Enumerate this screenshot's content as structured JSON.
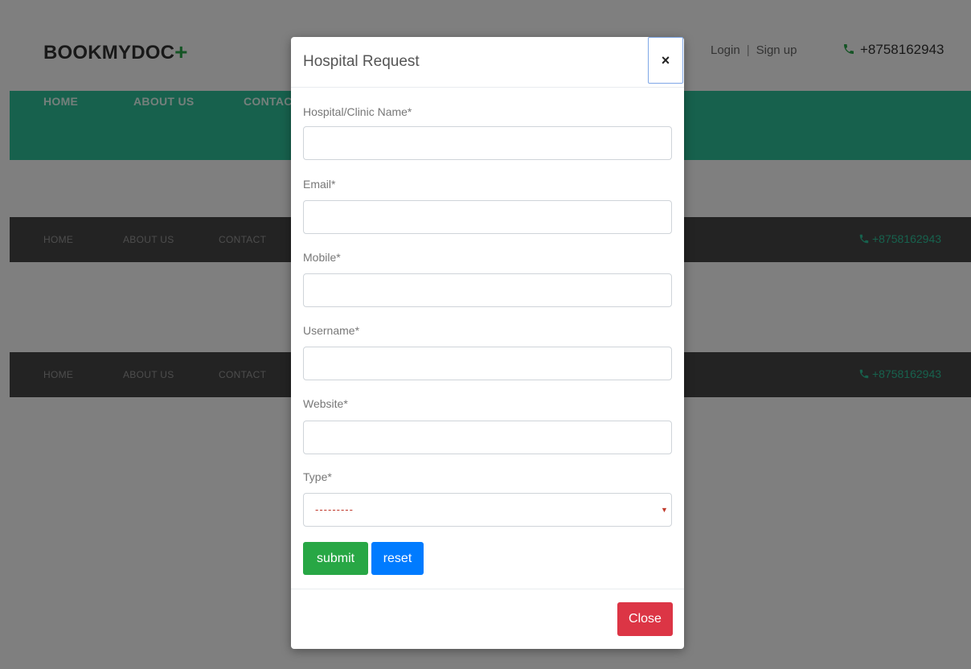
{
  "header": {
    "brand_text": "BOOKMYDOC",
    "brand_plus": "+",
    "login_label": "Login",
    "separator": "|",
    "signup_label": "Sign up",
    "phone": "+8758162943"
  },
  "green_nav": {
    "items": [
      "HOME",
      "ABOUT US",
      "CONTACT"
    ]
  },
  "dark_nav_1": {
    "items": [
      "HOME",
      "ABOUT US",
      "CONTACT"
    ],
    "phone": "+8758162943"
  },
  "dark_nav_2": {
    "items": [
      "HOME",
      "ABOUT US",
      "CONTACT"
    ],
    "phone": "+8758162943"
  },
  "modal": {
    "title": "Hospital Request",
    "close_x": "×",
    "fields": {
      "hospital_label": "Hospital/Clinic Name*",
      "hospital_value": "",
      "email_label": "Email*",
      "email_value": "",
      "mobile_label": "Mobile*",
      "mobile_value": "",
      "username_label": "Username*",
      "username_value": "",
      "website_label": "Website*",
      "website_value": "",
      "type_label": "Type*",
      "type_selected": "---------"
    },
    "submit_label": "submit",
    "reset_label": "reset",
    "close_label": "Close"
  },
  "colors": {
    "accent_green": "#2ec39a",
    "submit_green": "#28a745",
    "reset_blue": "#007bff",
    "close_red": "#dc3545"
  }
}
